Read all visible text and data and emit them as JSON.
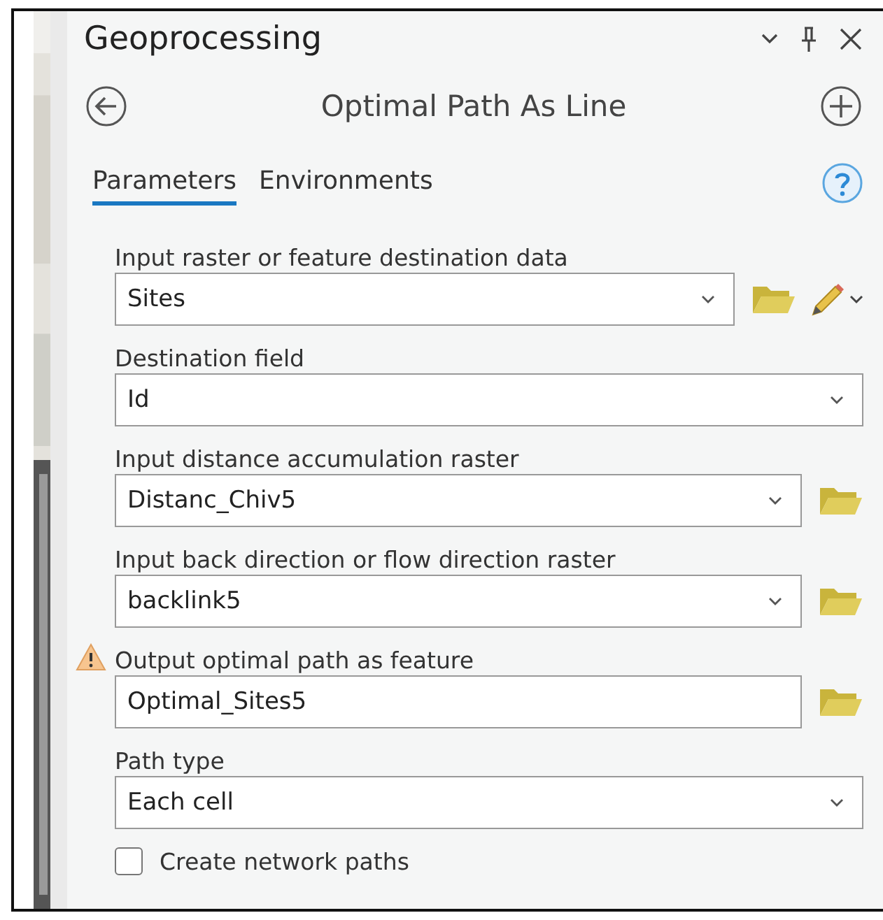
{
  "panel": {
    "title": "Geoprocessing"
  },
  "tool": {
    "title": "Optimal Path As Line"
  },
  "tabs": [
    {
      "label": "Parameters",
      "selected": true
    },
    {
      "label": "Environments",
      "selected": false
    }
  ],
  "parameters": [
    {
      "kind": "dropdown",
      "label": "Input raster or feature destination data",
      "value": "Sites",
      "browse": true,
      "sketch": true,
      "warning": false
    },
    {
      "kind": "dropdown",
      "label": "Destination field",
      "value": "Id",
      "browse": false,
      "sketch": false,
      "warning": false
    },
    {
      "kind": "dropdown",
      "label": "Input distance accumulation raster",
      "value": "Distanc_Chiv5",
      "browse": true,
      "sketch": false,
      "warning": false
    },
    {
      "kind": "dropdown",
      "label": "Input back direction or flow direction raster",
      "value": "backlink5",
      "browse": true,
      "sketch": false,
      "warning": false
    },
    {
      "kind": "text",
      "label": "Output optimal path as feature",
      "value": "Optimal_Sites5",
      "browse": true,
      "sketch": false,
      "warning": true
    },
    {
      "kind": "dropdown",
      "label": "Path type",
      "value": "Each cell",
      "browse": false,
      "sketch": false,
      "warning": false
    },
    {
      "kind": "checkbox",
      "label": "Create network paths",
      "checked": false
    }
  ]
}
